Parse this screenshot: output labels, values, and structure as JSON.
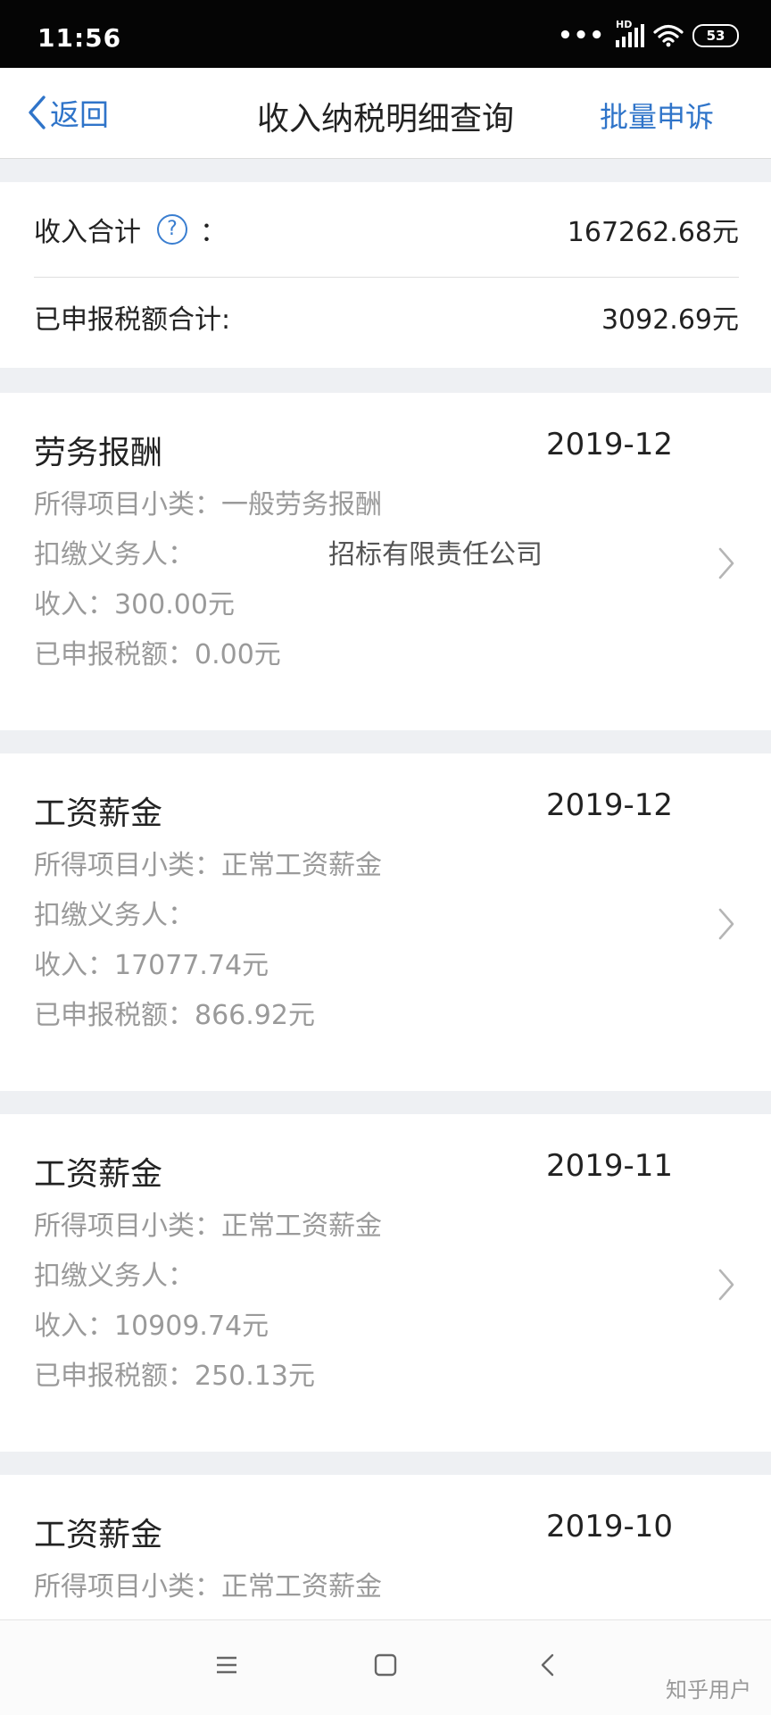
{
  "status_bar": {
    "time": "11:56",
    "dots": "•••",
    "network": "HD",
    "battery": "53"
  },
  "nav": {
    "back_label": "返回",
    "title": "收入纳税明细查询",
    "action_label": "批量申诉"
  },
  "summary": {
    "income_label": "收入合计",
    "help_glyph": "?",
    "colon": "：",
    "income_value": "167262.68元",
    "tax_label": "已申报税额合计:",
    "tax_value": "3092.69元"
  },
  "records": [
    {
      "category": "劳务报酬",
      "date": "2019-12",
      "subcategory": "所得项目小类：一般劳务报酬",
      "withholder": "扣缴义务人：",
      "withholder_name": "招标有限责任公司",
      "income": "收入：300.00元",
      "tax": "已申报税额：0.00元"
    },
    {
      "category": "工资薪金",
      "date": "2019-12",
      "subcategory": "所得项目小类：正常工资薪金",
      "withholder": "扣缴义务人：",
      "income": "收入：17077.74元",
      "tax": "已申报税额：866.92元"
    },
    {
      "category": "工资薪金",
      "date": "2019-11",
      "subcategory": "所得项目小类：正常工资薪金",
      "withholder": "扣缴义务人：",
      "income": "收入：10909.74元",
      "tax": "已申报税额：250.13元"
    },
    {
      "category": "工资薪金",
      "date": "2019-10",
      "subcategory": "所得项目小类：正常工资薪金"
    }
  ],
  "watermark": "知乎用户",
  "icons": [
    "back-chevron-icon",
    "help-icon",
    "chevron-right-icon",
    "menu-icon",
    "home-icon",
    "back-nav-icon",
    "wifi-icon",
    "signal-icon",
    "battery-icon"
  ],
  "colors": {
    "accent": "#2f74c9",
    "muted_text": "#9a9a9a",
    "page_bg": "#eef0f3"
  }
}
